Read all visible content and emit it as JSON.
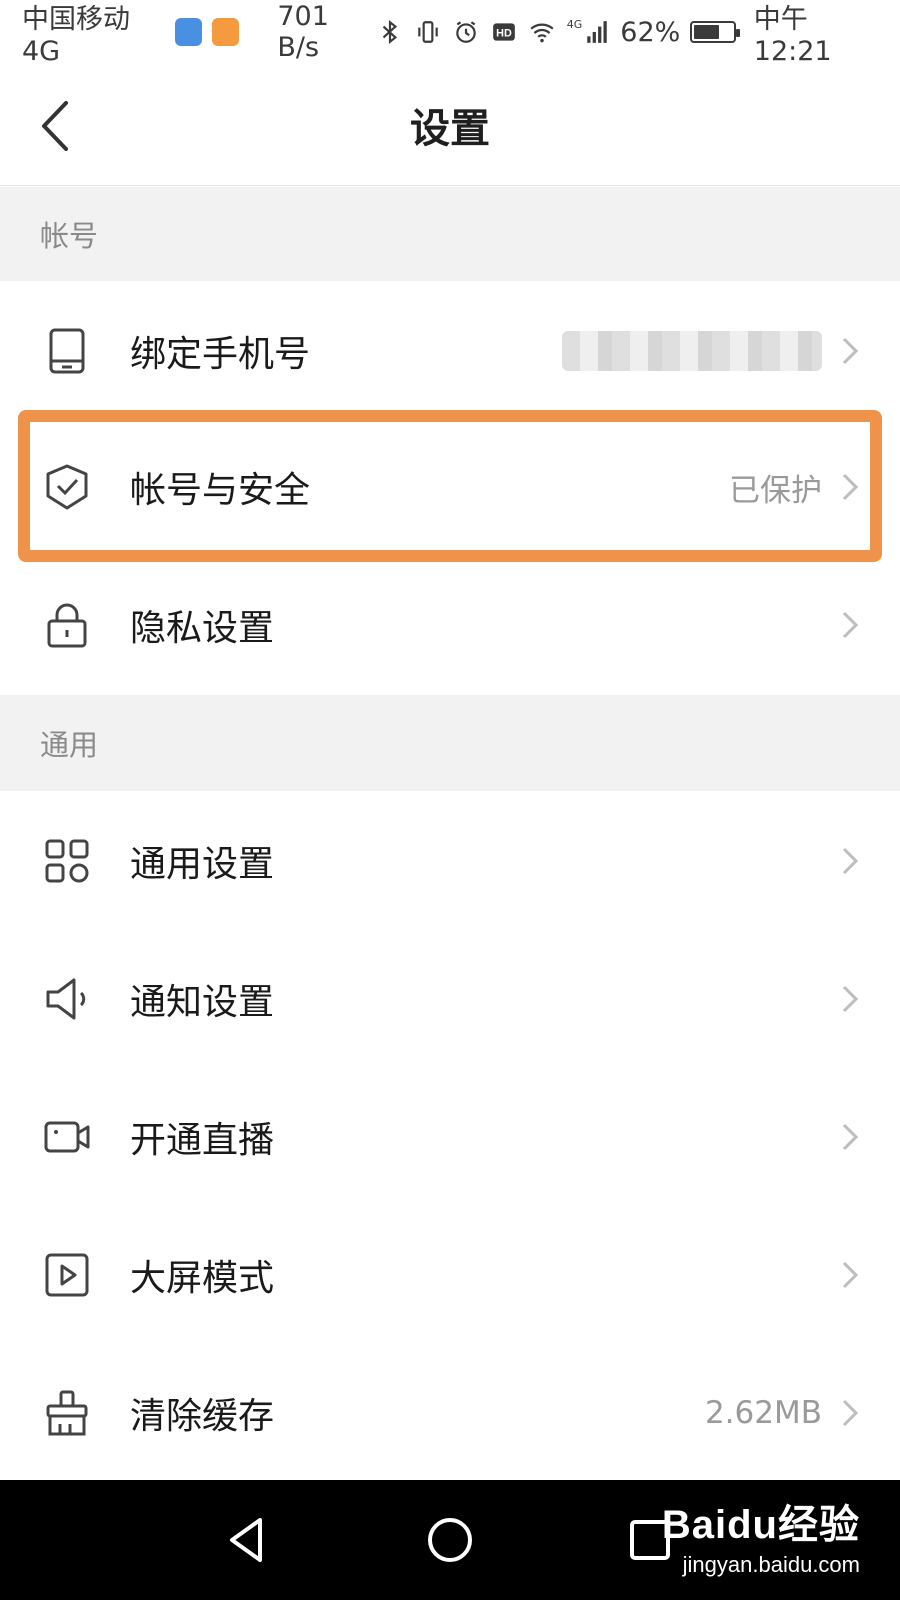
{
  "status_bar": {
    "carrier": "中国移动4G",
    "speed": "701 B/s",
    "network_badge": "4G",
    "battery": "62%",
    "battery_level": 0.62,
    "time": "中午12:21"
  },
  "header": {
    "title": "设置"
  },
  "sections": [
    {
      "title": "帐号",
      "items": [
        {
          "label": "绑定手机号",
          "value": "",
          "icon": "phone-icon",
          "value_masked": true
        },
        {
          "label": "帐号与安全",
          "value": "已保护",
          "icon": "shield-check-icon",
          "highlighted": true
        },
        {
          "label": "隐私设置",
          "value": "",
          "icon": "lock-icon"
        }
      ]
    },
    {
      "title": "通用",
      "items": [
        {
          "label": "通用设置",
          "value": "",
          "icon": "grid-icon"
        },
        {
          "label": "通知设置",
          "value": "",
          "icon": "speaker-icon"
        },
        {
          "label": "开通直播",
          "value": "",
          "icon": "video-camera-icon"
        },
        {
          "label": "大屏模式",
          "value": "",
          "icon": "play-square-icon"
        },
        {
          "label": "清除缓存",
          "value": "2.62MB",
          "icon": "brush-icon"
        }
      ]
    }
  ],
  "watermark": {
    "logo": "Baidu经验",
    "url": "jingyan.baidu.com"
  },
  "colors": {
    "highlight": "#f0934a",
    "section_bg": "#f2f2f2",
    "nav_bg": "#000000"
  }
}
